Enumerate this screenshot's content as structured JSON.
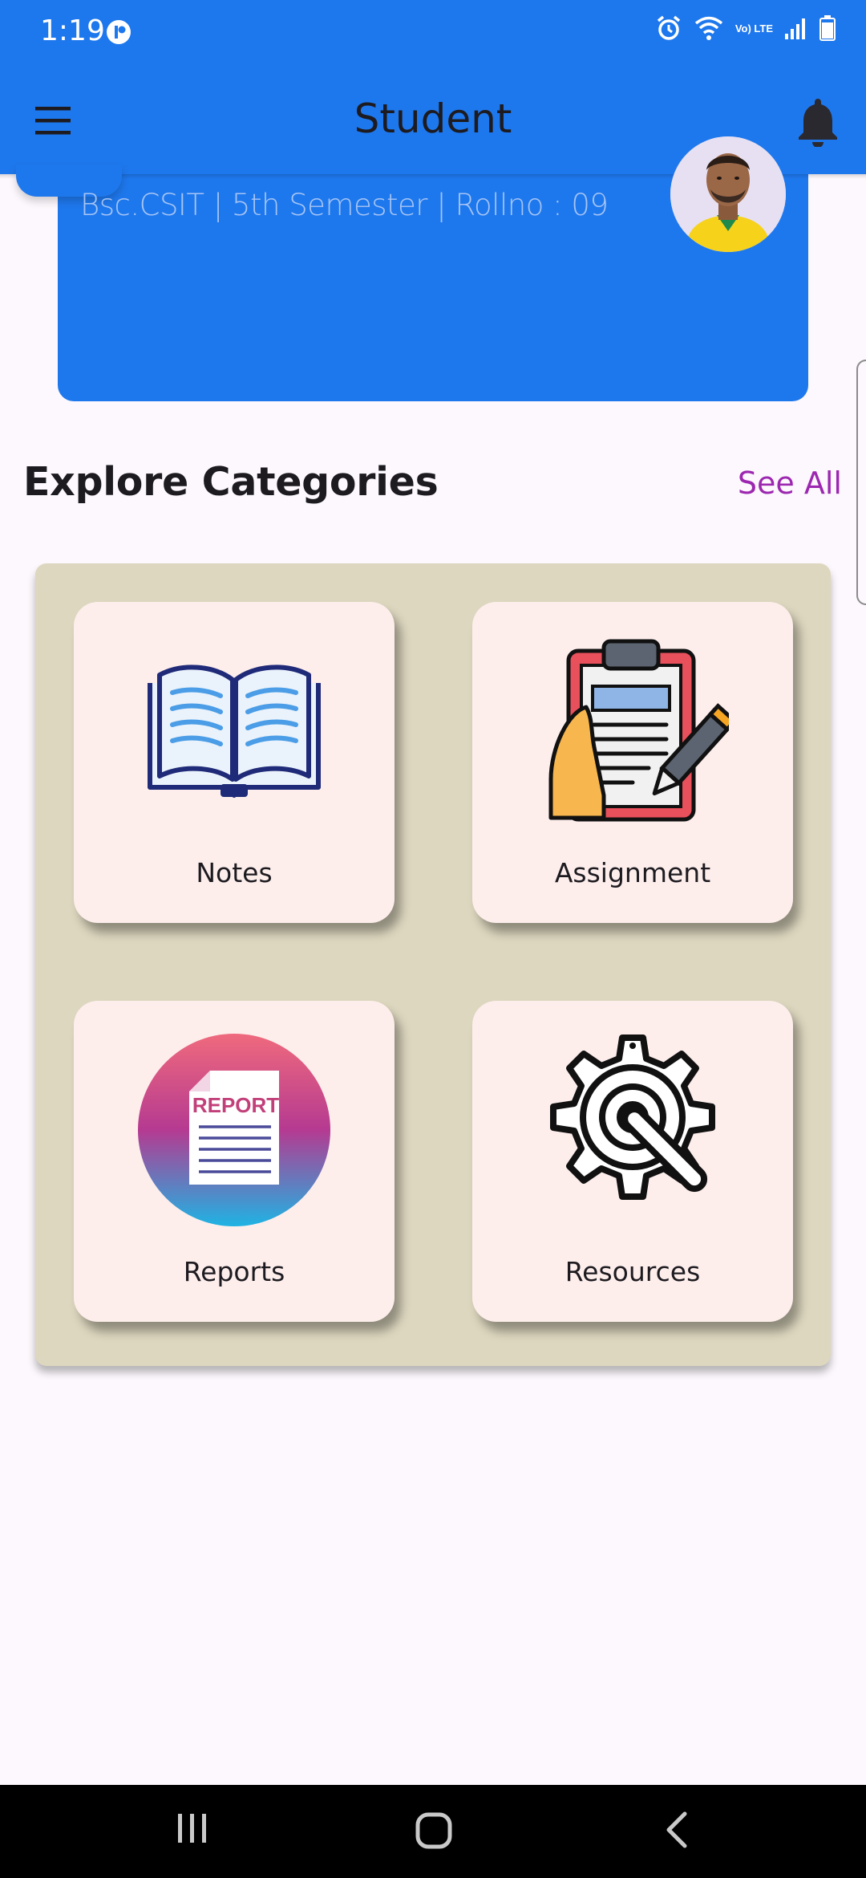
{
  "status_bar": {
    "time": "1:19",
    "network_label": "Vo) LTE",
    "icons": [
      "app-notification-icon",
      "alarm-icon",
      "wifi-icon",
      "volte-icon",
      "signal-icon",
      "battery-icon"
    ]
  },
  "app_bar": {
    "title": "Student",
    "menu_icon": "hamburger-menu-icon",
    "notification_icon": "bell-icon",
    "color": "#1e78ed"
  },
  "profile": {
    "subtitle": "Bsc.CSIT | 5th Semester | Rollno : 09"
  },
  "categories": {
    "title": "Explore Categories",
    "see_all": "See All",
    "items": [
      {
        "label": "Notes",
        "icon": "open-book-icon"
      },
      {
        "label": "Assignment",
        "icon": "clipboard-pencil-icon"
      },
      {
        "label": "Reports",
        "icon": "report-document-icon"
      },
      {
        "label": "Resources",
        "icon": "gear-wrench-icon"
      }
    ]
  },
  "nav_bar": {
    "icons": [
      "recents-icon",
      "home-icon",
      "back-icon"
    ]
  },
  "colors": {
    "primary": "#1e78ed",
    "accent": "#9c27b0",
    "panel": "#ddd7bf",
    "tile": "#fdeeec"
  }
}
